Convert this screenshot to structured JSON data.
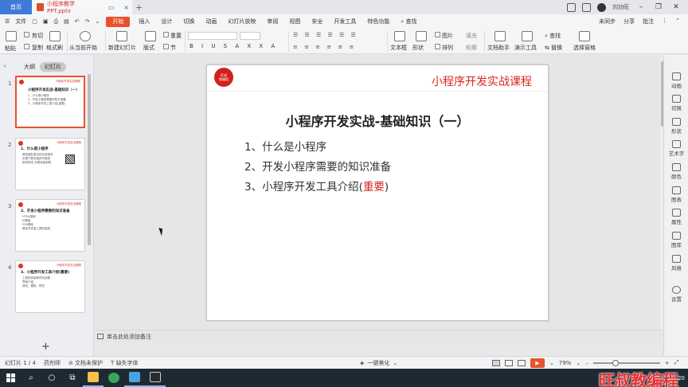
{
  "titlebar": {
    "home_tab": "首页",
    "doc_tab": "小程序教学PPT.pptx",
    "add_tab": "+",
    "user_name": "刘功旺"
  },
  "menubar": {
    "file": "文件",
    "items": [
      "开始",
      "插入",
      "设计",
      "切换",
      "动画",
      "幻灯片放映",
      "审阅",
      "视图",
      "安全",
      "开发工具",
      "特色功能",
      "查找"
    ],
    "right_items": [
      "未同步",
      "分享",
      "批注"
    ]
  },
  "ribbon": {
    "paste": "粘贴",
    "cut": "剪切",
    "copy": "复制",
    "format_painter": "格式刷",
    "from_current": "从当前开始",
    "new_slide": "新建幻灯片",
    "layout": "版式",
    "section": "节",
    "reset": "重置",
    "text_box": "文本框",
    "shape": "形状",
    "arrange": "排列",
    "picture": "图片",
    "fill": "填充",
    "outline": "轮廓",
    "doc_helper": "文档助手",
    "present_tools": "演示工具",
    "find": "查找",
    "replace": "替换",
    "select_pane": "选择窗格"
  },
  "leftpanel": {
    "outline_tab": "大纲",
    "slides_tab": "幻灯片",
    "thumbs": [
      {
        "num": "1",
        "header": "小程序开发实战课程",
        "title": "小程序开发实战-基础知识（一）",
        "lines": [
          "1、什么是小程序",
          "2、开发小程序需要的知识准备",
          "3、小程序开发工具介绍(重要)"
        ]
      },
      {
        "num": "2",
        "header": "小程序开发实战课程",
        "title": "1、什么是小程序",
        "lines": [
          "微信团队推出的应用程序",
          "无需下载安装即可使用",
          "用完即走 无需安装卸载"
        ]
      },
      {
        "num": "3",
        "header": "小程序开发实战课程",
        "title": "2、开发小程序需要的知识准备",
        "lines": [
          "HTML基础",
          "JS基础",
          "CSS基础",
          "微信开发者工具的使用"
        ]
      },
      {
        "num": "4",
        "header": "小程序开发实战课程",
        "title": "3、小程序开发工具介绍(重要)",
        "lines": [
          "工具的安装和项目创建",
          "界面介绍",
          "调试、模拟、预览"
        ]
      }
    ],
    "add": "+"
  },
  "slide": {
    "logo_line1": "旺叔",
    "logo_line2": "教编程",
    "header": "小程序开发实战课程",
    "title": "小程序开发实战-基础知识（一）",
    "item1": "1、什么是小程序",
    "item2": "2、开发小程序需要的知识准备",
    "item3_prefix": "3、小程序开发工具介绍(",
    "item3_em": "重要",
    "item3_suffix": ")"
  },
  "notes": {
    "placeholder": "单击此处添加备注"
  },
  "rightpanel": [
    "动画",
    "切换",
    "形状",
    "艺术字",
    "颜色",
    "图表",
    "属性",
    "图库",
    "风格",
    "设置"
  ],
  "statusbar": {
    "slide_info": "幻灯片 1 / 4",
    "theme": "药剂师",
    "protect": "文档未保护",
    "font_missing": "缺失字体",
    "beautify": "一键美化",
    "zoom": "79%"
  },
  "taskbar": {
    "time": "20"
  },
  "watermark": "旺叔教编程",
  "colors": {
    "accent": "#e8522c",
    "slide_red": "#d9261c",
    "home_tab": "#3d7bd6"
  }
}
